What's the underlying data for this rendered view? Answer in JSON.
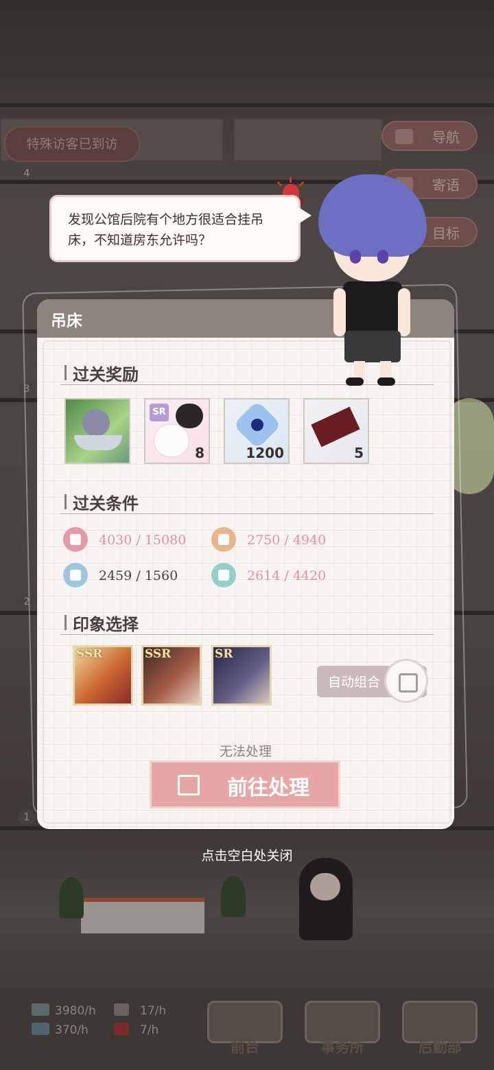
{
  "hud": {
    "visitor_notice": "特殊访客已到访",
    "side_buttons": [
      {
        "label": "导航",
        "icon": "map-icon"
      },
      {
        "label": "寄语",
        "icon": "message-icon"
      },
      {
        "label": "目标",
        "icon": "target-icon"
      }
    ],
    "floors": [
      "4",
      "3",
      "2",
      "1"
    ]
  },
  "speech": {
    "text": "发现公馆后院有个地方很适合挂吊床，不知道房东允许吗？"
  },
  "panel": {
    "title": "吊床",
    "sections": {
      "rewards": "过关奖励",
      "conditions": "过关条件",
      "impression": "印象选择"
    },
    "rewards": [
      {
        "name": "hammock-character-item",
        "count": ""
      },
      {
        "name": "cat-sr-card-item",
        "badge": "SR",
        "count": "8"
      },
      {
        "name": "blue-crystal-item",
        "count": "1200"
      },
      {
        "name": "ticket-item",
        "count": "5"
      }
    ],
    "conditions": [
      {
        "icon": "strength-icon",
        "current": "4030",
        "required": "/ 15080",
        "met": false,
        "color": "#e49aa6"
      },
      {
        "icon": "person-icon",
        "current": "2750",
        "required": "/ 4940",
        "met": false,
        "color": "#e8b48e"
      },
      {
        "icon": "graduation-cap-icon",
        "current": "2459",
        "required": "/ 1560",
        "met": true,
        "color": "#9fc6e0"
      },
      {
        "icon": "flower-icon",
        "current": "2614",
        "required": "/ 4420",
        "met": false,
        "color": "#95cfc8"
      }
    ],
    "impression_cards": [
      {
        "rarity": "SSR",
        "tone": "#d9a24a"
      },
      {
        "rarity": "SSR",
        "tone": "#8a4a3a"
      },
      {
        "rarity": "SR",
        "tone": "#3f3a5c"
      }
    ],
    "auto_combine": "自动组合",
    "cannot_handle": "无法处理",
    "go_handle": "前往处理"
  },
  "close_hint": "点击空白处关闭",
  "bottom": {
    "resources": [
      {
        "icon": "cash-icon",
        "value": "3980/h"
      },
      {
        "icon": "book-icon",
        "value": "370/h"
      },
      {
        "icon": "fan-icon",
        "value": "17/h"
      },
      {
        "icon": "gift-icon",
        "value": "7/h"
      }
    ],
    "nav": [
      {
        "label": "前台",
        "icon": "front-desk-icon"
      },
      {
        "label": "事务所",
        "icon": "office-icon"
      },
      {
        "label": "后勤部",
        "icon": "logistics-icon"
      }
    ]
  },
  "colors": {
    "accent": "#e8a7a7",
    "header": "#8f837e",
    "condition_unmet": "#e4909c",
    "condition_met": "#4b3f3b"
  }
}
